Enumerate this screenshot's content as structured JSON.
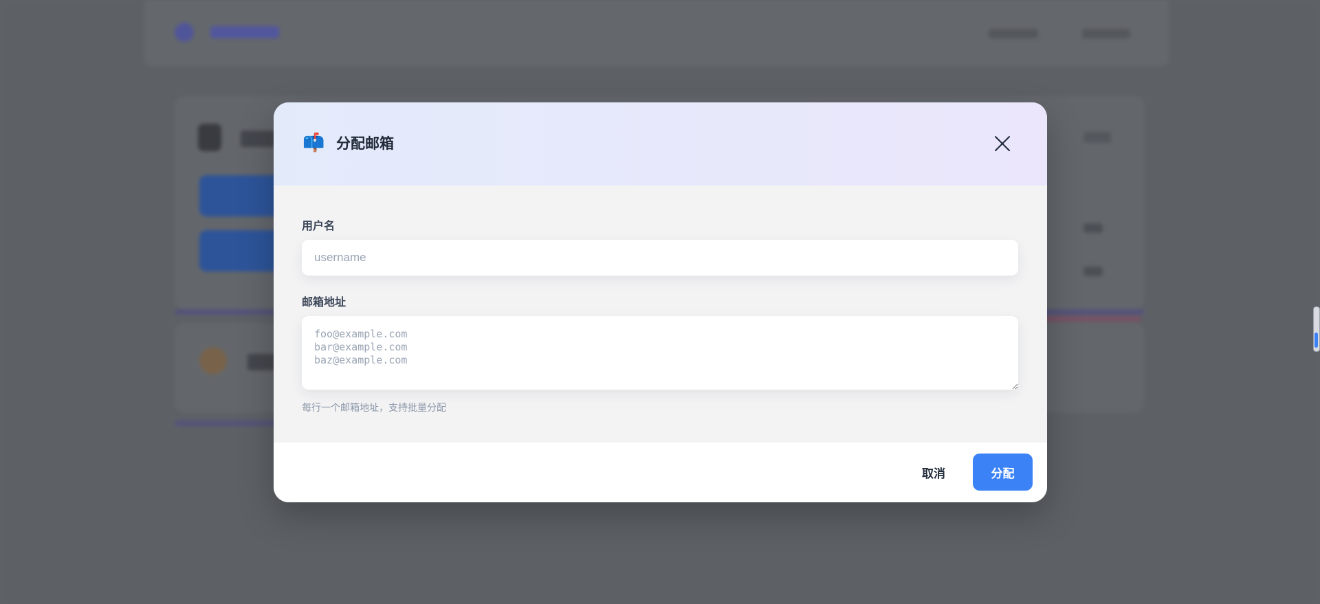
{
  "modal": {
    "icon": "📫",
    "icon_name": "mailbox-icon",
    "title": "分配邮箱",
    "close_icon": "close-icon"
  },
  "form": {
    "username": {
      "label": "用户名",
      "value": "",
      "placeholder": "username"
    },
    "emails": {
      "label": "邮箱地址",
      "value": "",
      "placeholder": "foo@example.com\nbar@example.com\nbaz@example.com",
      "helper": "每行一个邮箱地址，支持批量分配"
    }
  },
  "footer": {
    "cancel_label": "取消",
    "submit_label": "分配"
  },
  "colors": {
    "primary": "#3b82f6",
    "header_gradient_start": "#e3ebfb",
    "header_gradient_end": "#ebe6fb"
  }
}
